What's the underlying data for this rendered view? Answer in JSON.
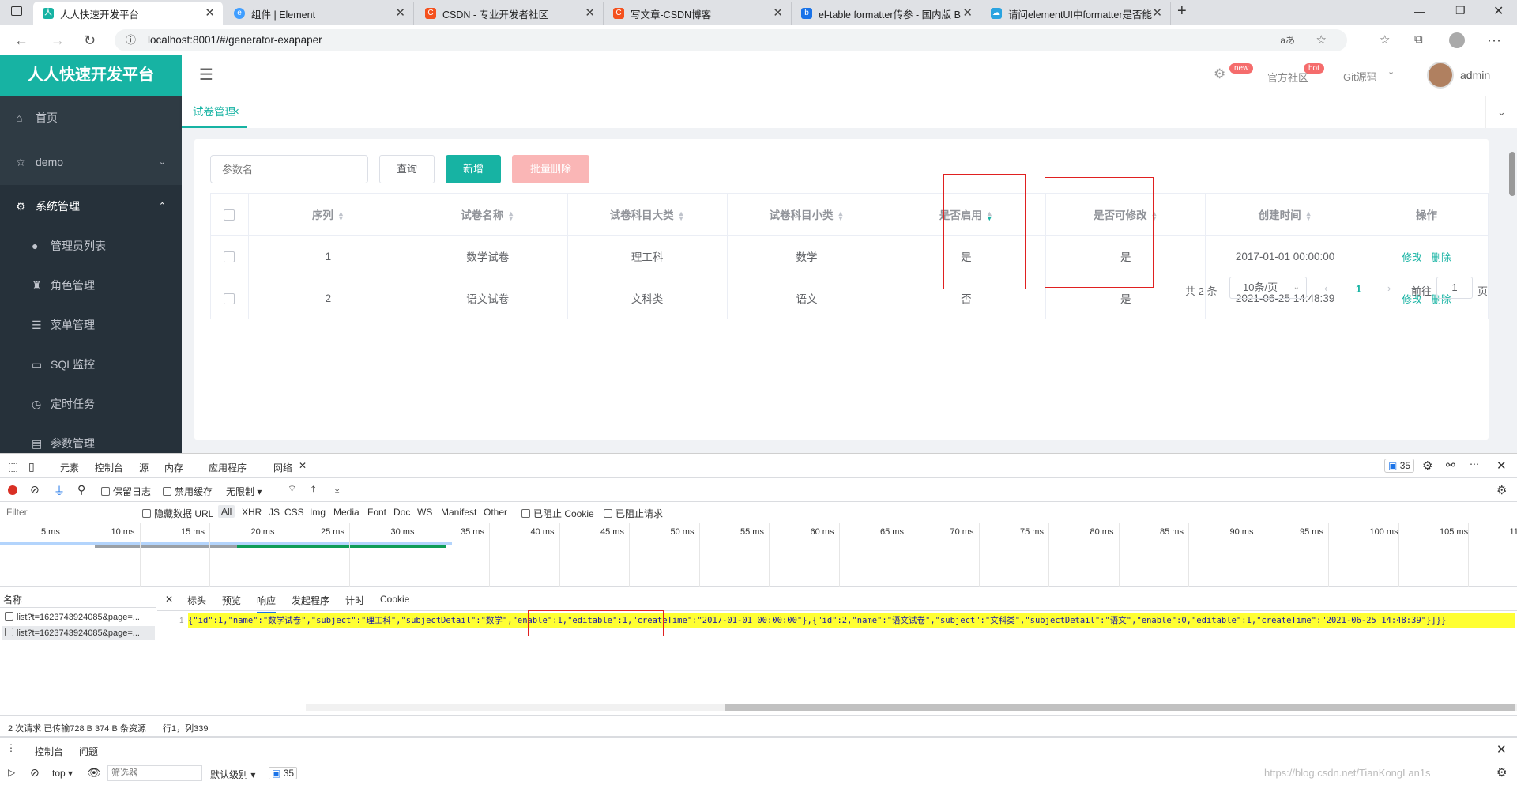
{
  "browser": {
    "tabs": [
      {
        "title": "人人快速开发平台",
        "icon": "green-favicon"
      },
      {
        "title": "组件 | Element",
        "icon": "element-favicon"
      },
      {
        "title": "CSDN - 专业开发者社区",
        "icon": "csdn-favicon"
      },
      {
        "title": "写文章-CSDN博客",
        "icon": "csdn-favicon"
      },
      {
        "title": "el-table formatter传参 - 国内版 B",
        "icon": "bing-favicon"
      },
      {
        "title": "请问elementUI中formatter是否能",
        "icon": "cloud-favicon"
      }
    ],
    "new_tab": "+",
    "url": "localhost:8001/#/generator-exapaper"
  },
  "app": {
    "brand": "人人快速开发平台",
    "menu": [
      {
        "label": "首页",
        "icon": "home-icon"
      },
      {
        "label": "demo",
        "icon": "star-icon"
      },
      {
        "label": "系统管理",
        "icon": "gear-icon"
      },
      {
        "label": "管理员列表",
        "icon": "user-icon"
      },
      {
        "label": "角色管理",
        "icon": "role-icon"
      },
      {
        "label": "菜单管理",
        "icon": "list-icon"
      },
      {
        "label": "SQL监控",
        "icon": "monitor-icon"
      },
      {
        "label": "定时任务",
        "icon": "clock-icon"
      },
      {
        "label": "参数管理",
        "icon": "params-icon"
      }
    ],
    "header": {
      "badge_new": "new",
      "community": "官方社区",
      "badge_hot": "hot",
      "git": "Git源码",
      "user": "admin"
    },
    "active_tab": "试卷管理",
    "toolbar": {
      "param_placeholder": "参数名",
      "query": "查询",
      "add": "新增",
      "batch_delete": "批量删除"
    },
    "table": {
      "headers": [
        "序列",
        "试卷名称",
        "试卷科目大类",
        "试卷科目小类",
        "是否启用",
        "是否可修改",
        "创建时间",
        "操作"
      ],
      "rows": [
        [
          "1",
          "数学试卷",
          "理工科",
          "数学",
          "是",
          "是",
          "2017-01-01 00:00:00"
        ],
        [
          "2",
          "语文试卷",
          "文科类",
          "语文",
          "否",
          "是",
          "2021-06-25 14:48:39"
        ]
      ],
      "edit": "修改",
      "delete": "删除"
    },
    "pagination": {
      "total": "共 2 条",
      "page_size": "10条/页",
      "current": "1",
      "goto": "前往",
      "goto_value": "1",
      "page_unit": "页"
    }
  },
  "devtools": {
    "tabs": [
      "元素",
      "控制台",
      "源",
      "内存",
      "应用程序",
      "网络"
    ],
    "issues_count": "35",
    "toolbar": {
      "preserve_log": "保留日志",
      "disable_cache": "禁用缓存",
      "throttle": "无限制"
    },
    "filter": {
      "placeholder": "Filter",
      "hide_data_urls": "隐藏数据 URL",
      "types": [
        "All",
        "XHR",
        "JS",
        "CSS",
        "Img",
        "Media",
        "Font",
        "Doc",
        "WS",
        "Manifest",
        "Other"
      ],
      "blocked_cookies": "已阻止 Cookie",
      "blocked_requests": "已阻止请求"
    },
    "timeline_ticks": [
      "5 ms",
      "10 ms",
      "15 ms",
      "20 ms",
      "25 ms",
      "30 ms",
      "35 ms",
      "40 ms",
      "45 ms",
      "50 ms",
      "55 ms",
      "60 ms",
      "65 ms",
      "70 ms",
      "75 ms",
      "80 ms",
      "85 ms",
      "90 ms",
      "95 ms",
      "100 ms",
      "105 ms",
      "11"
    ],
    "name_header": "名称",
    "requests": [
      "list?t=1623743924085&page=...",
      "list?t=1623743924085&page=..."
    ],
    "detail_tabs": [
      "标头",
      "预览",
      "响应",
      "发起程序",
      "计时",
      "Cookie"
    ],
    "line_number": "1",
    "response": "{\"id\":1,\"name\":\"数学试卷\",\"subject\":\"理工科\",\"subjectDetail\":\"数学\",\"enable\":1,\"editable\":1,\"createTime\":\"2017-01-01 00:00:00\"},{\"id\":2,\"name\":\"语文试卷\",\"subject\":\"文科类\",\"subjectDetail\":\"语文\",\"enable\":0,\"editable\":1,\"createTime\":\"2021-06-25 14:48:39\"}]}}",
    "status_left": "2 次请求  已传输728 B  374 B 条资源",
    "status_pos": "行1，列339",
    "drawer_tabs": [
      "控制台",
      "问题"
    ],
    "console_context": "top",
    "console_filter": "筛选器",
    "log_level": "默认级别",
    "console_issues": "35",
    "watermark": "https://blog.csdn.net/TianKongLan1s"
  }
}
